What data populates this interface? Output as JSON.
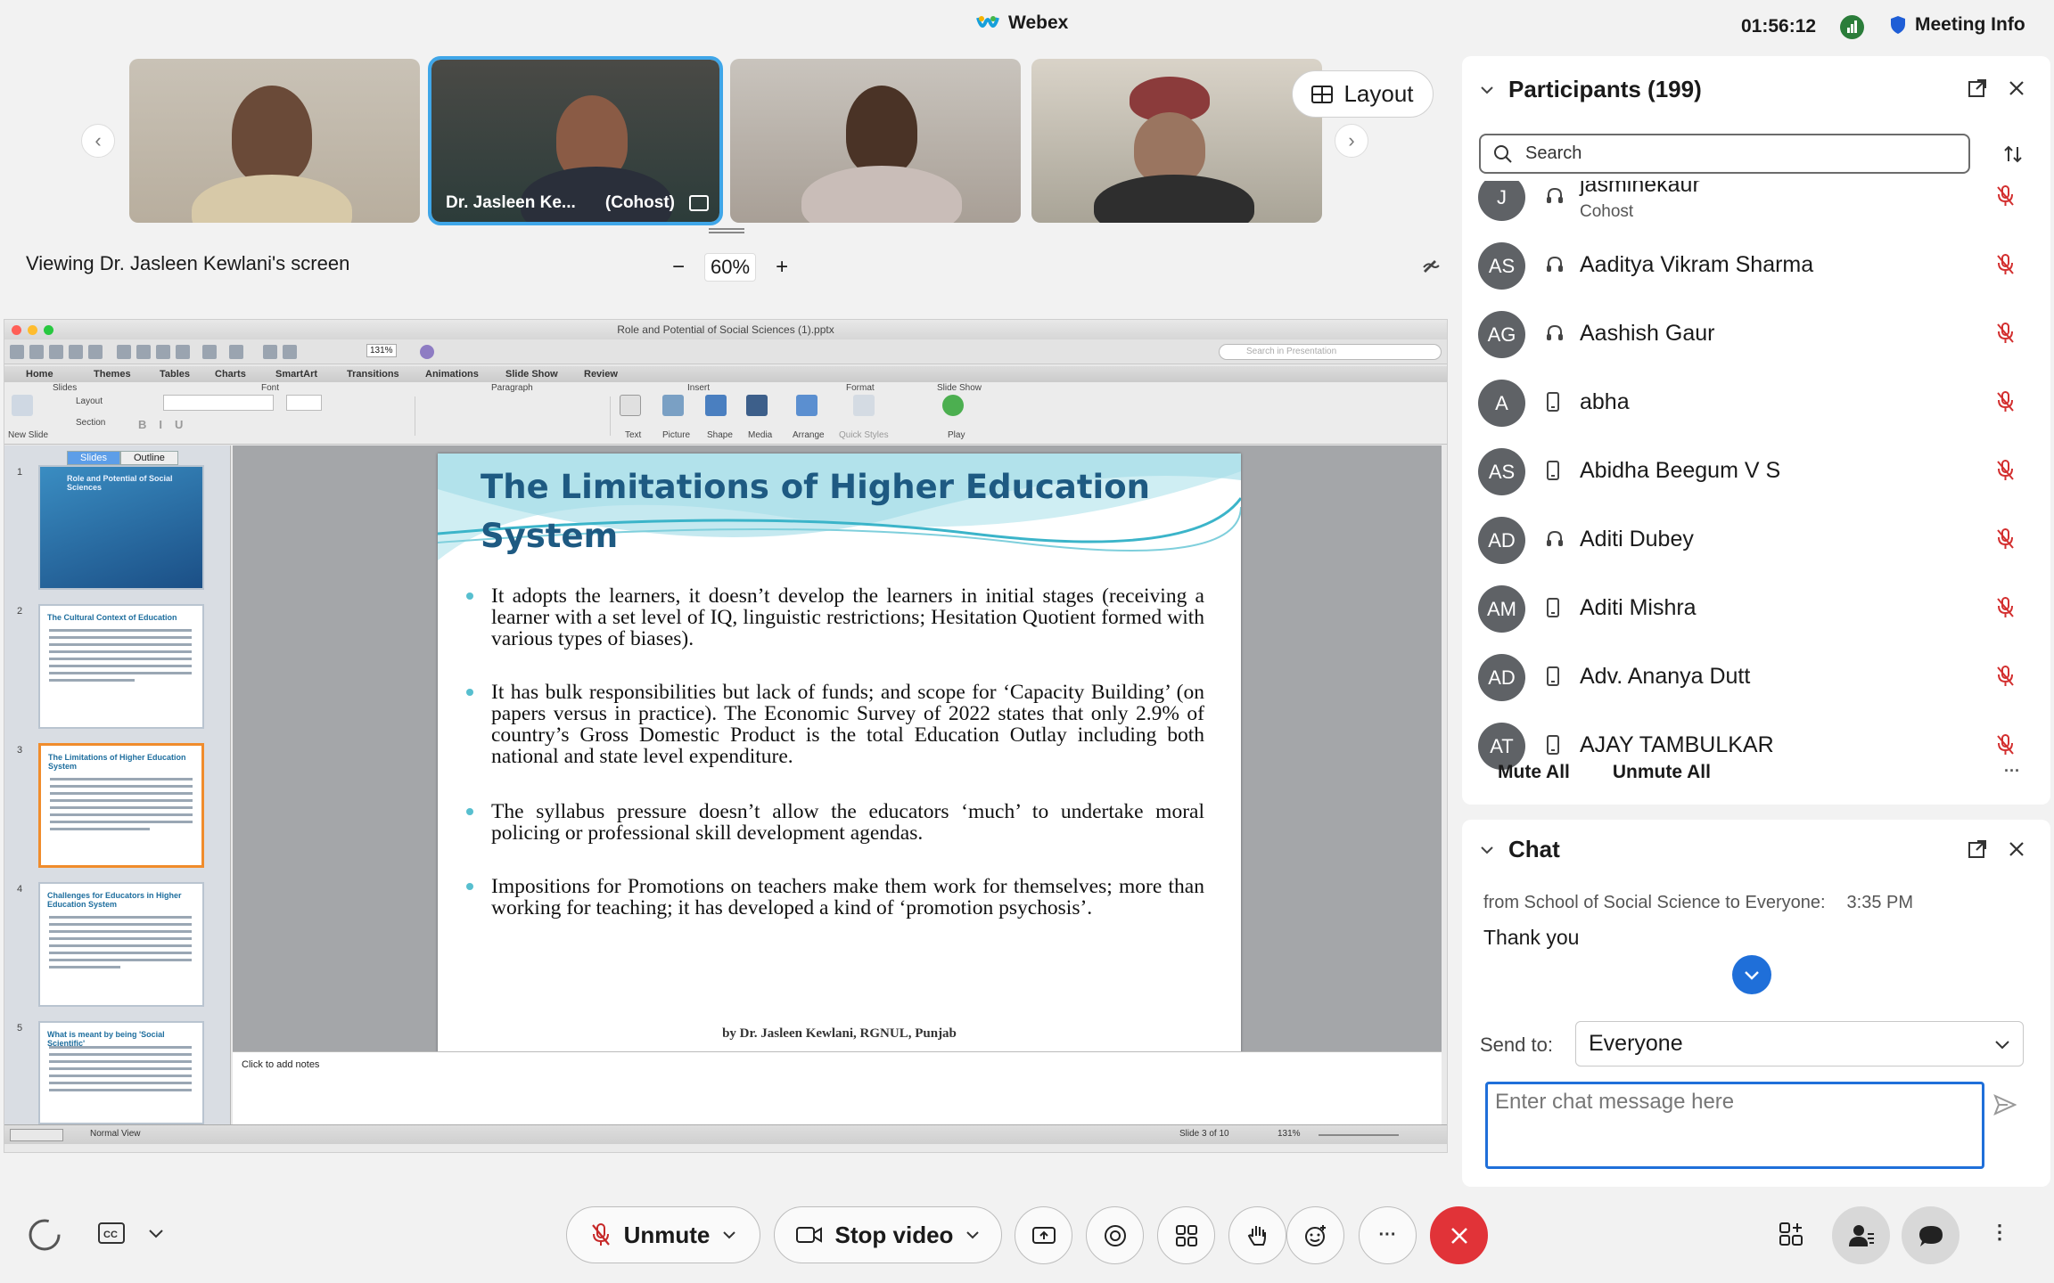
{
  "app": {
    "title": "Webex",
    "time": "01:56:12",
    "meeting_info": "Meeting Info"
  },
  "video_strip": {
    "tiles": [
      {
        "name": ""
      },
      {
        "name": "Dr. Jasleen Ke...",
        "role": "(Cohost)"
      },
      {
        "name": ""
      },
      {
        "name": ""
      }
    ],
    "layout_label": "Layout"
  },
  "share": {
    "viewing_text": "Viewing Dr. Jasleen Kewlani's screen",
    "zoom": "60%",
    "zoom_minus": "−",
    "zoom_plus": "+"
  },
  "ppt": {
    "file_title": "Role and Potential of Social Sciences (1).pptx",
    "zoom_box": "131%",
    "search_placeholder": "Search in Presentation",
    "ribbon_tabs": [
      "Home",
      "Themes",
      "Tables",
      "Charts",
      "SmartArt",
      "Transitions",
      "Animations",
      "Slide Show",
      "Review"
    ],
    "ribbon_groups": [
      "Slides",
      "Font",
      "Paragraph",
      "Insert",
      "Format",
      "Slide Show"
    ],
    "ribbon_buttons": {
      "new_slide": "New Slide",
      "layout": "Layout",
      "section": "Section",
      "text": "Text",
      "picture": "Picture",
      "shape": "Shape",
      "media": "Media",
      "arrange": "Arrange",
      "quick_styles": "Quick Styles",
      "play": "Play"
    },
    "panel_tabs": [
      "Slides",
      "Outline"
    ],
    "thumbnails": [
      {
        "num": "1",
        "title": "Role and Potential of Social Sciences"
      },
      {
        "num": "2",
        "title": "The Cultural Context of Education"
      },
      {
        "num": "3",
        "title": "The Limitations of Higher Education System"
      },
      {
        "num": "4",
        "title": "Challenges for Educators in Higher Education System"
      },
      {
        "num": "5",
        "title": "What is meant by being 'Social Scientific'"
      }
    ],
    "slide": {
      "title": "The Limitations of Higher Education System",
      "bullets": [
        "It adopts the learners, it doesn’t develop the learners in initial stages (receiving a learner with a set level of IQ, linguistic restrictions; Hesitation Quotient formed with various types of biases).",
        "It has bulk responsibilities but lack of funds; and scope for ‘Capacity Building’ (on papers versus in practice). The Economic Survey of 2022 states that only 2.9% of country’s Gross Domestic Product is the total Education Outlay including both national and state level expenditure.",
        "The syllabus pressure doesn’t allow the educators ‘much’ to undertake moral policing or professional skill development agendas.",
        "Impositions for Promotions on teachers make them work for themselves; more than working for teaching; it has developed a kind of ‘promotion psychosis’."
      ],
      "footer": "by Dr. Jasleen Kewlani, RGNUL, Punjab"
    },
    "notes_placeholder": "Click to add notes",
    "status": {
      "view": "Normal View",
      "slide_counter": "Slide 3 of 10",
      "zoom": "131%"
    }
  },
  "participants": {
    "header": "Participants (199)",
    "search_placeholder": "Search",
    "list": [
      {
        "initials": "J",
        "name": "jasminekaur",
        "sub": "Cohost",
        "device": "headset"
      },
      {
        "initials": "AS",
        "name": "Aaditya Vikram Sharma",
        "device": "headset"
      },
      {
        "initials": "AG",
        "name": "Aashish Gaur",
        "device": "headset"
      },
      {
        "initials": "A",
        "name": "abha",
        "device": "phone"
      },
      {
        "initials": "AS",
        "name": "Abidha Beegum V S",
        "device": "phone"
      },
      {
        "initials": "AD",
        "name": "Aditi Dubey",
        "device": "headset"
      },
      {
        "initials": "AM",
        "name": "Aditi Mishra",
        "device": "phone"
      },
      {
        "initials": "AD",
        "name": "Adv. Ananya Dutt",
        "device": "phone"
      },
      {
        "initials": "AT",
        "name": "AJAY TAMBULKAR",
        "device": "phone"
      }
    ],
    "mute_all": "Mute All",
    "unmute_all": "Unmute All",
    "more": "···"
  },
  "chat": {
    "header": "Chat",
    "from": "from School of Social Science to Everyone:",
    "time": "3:35  PM",
    "message": "Thank you",
    "send_to_label": "Send to:",
    "send_to_value": "Everyone",
    "input_placeholder": "Enter chat message here"
  },
  "controls": {
    "unmute": "Unmute",
    "stop_video": "Stop video",
    "cc": "CC",
    "more": "···"
  },
  "colors": {
    "accent": "#1f6fd9",
    "end_call": "#e13338",
    "slide_title": "#1e5a82",
    "active_thumb": "#f08c2c",
    "active_tile": "#3fa6e8"
  }
}
